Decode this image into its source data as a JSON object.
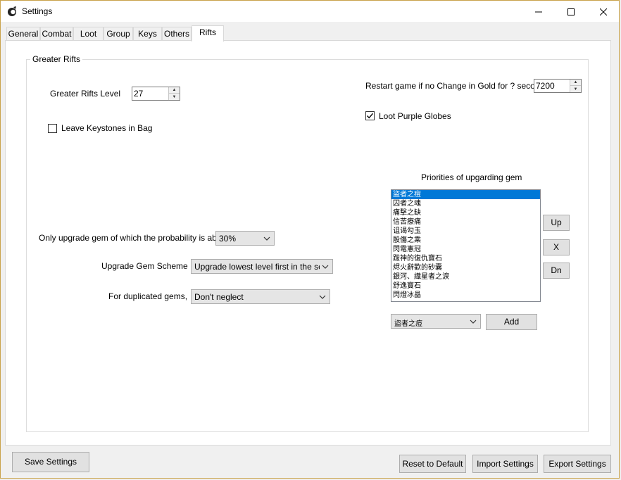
{
  "window": {
    "title": "Settings",
    "minimize_glyph": "—",
    "maximize_glyph": "☐",
    "close_glyph": "✕"
  },
  "tabs": [
    {
      "label": "General"
    },
    {
      "label": "Combat"
    },
    {
      "label": "Loot"
    },
    {
      "label": "Group"
    },
    {
      "label": "Keys"
    },
    {
      "label": "Others"
    },
    {
      "label": "Rifts"
    }
  ],
  "rifts": {
    "group_title": "Greater Rifts",
    "level_label": "Greater Rifts Level",
    "level_value": "27",
    "leave_keystones_label": "Leave Keystones in Bag",
    "leave_keystones_checked": false,
    "restart_label": "Restart game if no Change in Gold for ? seconds",
    "restart_value": "7200",
    "loot_globes_label": "Loot Purple Globes",
    "loot_globes_checked": true,
    "priorities_label": "Priorities of upgarding gem",
    "priorities": [
      "盜者之痘",
      "囚者之魂",
      "痛擊之缺",
      "信苦療痛",
      "诅谒勾玉",
      "殷傷之乘",
      "閃電憲冠",
      "跋神的復仇寶石",
      "烬火辭歡的砂囊",
      "銀河、織星者之淚",
      "舒逸寶石",
      "閃燈冰晶"
    ],
    "probability_label": "Only upgrade gem of which the probability is above",
    "probability_value": "30%",
    "scheme_label": "Upgrade Gem Scheme",
    "scheme_value": "Upgrade lowest level first in the selcte",
    "duplicated_label": "For duplicated gems,",
    "duplicated_value": "Don't neglect",
    "gem_select_value": "盜者之痘",
    "up_label": "Up",
    "remove_label": "X",
    "down_label": "Dn",
    "add_label": "Add"
  },
  "footer": {
    "save_label": "Save Settings",
    "reset_label": "Reset to Default",
    "import_label": "Import Settings",
    "export_label": "Export Settings"
  },
  "colors": {
    "selection": "#0078d7",
    "frame_border": "#c9a24a"
  }
}
